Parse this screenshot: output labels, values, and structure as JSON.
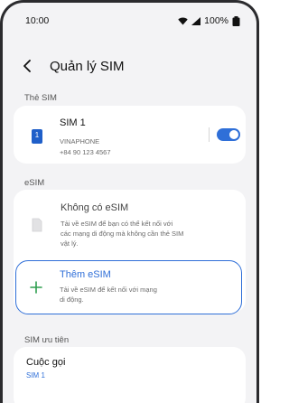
{
  "status_bar": {
    "time": "10:00",
    "battery": "100%"
  },
  "header": {
    "title": "Quản lý SIM"
  },
  "sections": {
    "physical_sim_label": "Thẻ SIM",
    "esim_label": "eSIM",
    "priority_label": "SIM ưu tiên"
  },
  "sim1": {
    "slot_number": "1",
    "name": "SIM 1",
    "carrier": "VINAPHONE",
    "number": "+84 90 123 4567",
    "enabled": true
  },
  "no_esim": {
    "title": "Không có eSIM",
    "description_lines": [
      "Tải về eSIM để bạn có thể kết nối với",
      "các mạng di động mà không cần thẻ SIM",
      "vật lý."
    ]
  },
  "add_esim": {
    "title": "Thêm eSIM",
    "description_lines": [
      "Tải về eSIM để kết nối với mạng",
      "di động."
    ]
  },
  "calls": {
    "title": "Cuộc gọi",
    "value": "SIM 1"
  },
  "colors": {
    "accent": "#2f6fd8",
    "sim_icon": "#1f5fc9",
    "plus": "#2e9e4f"
  }
}
